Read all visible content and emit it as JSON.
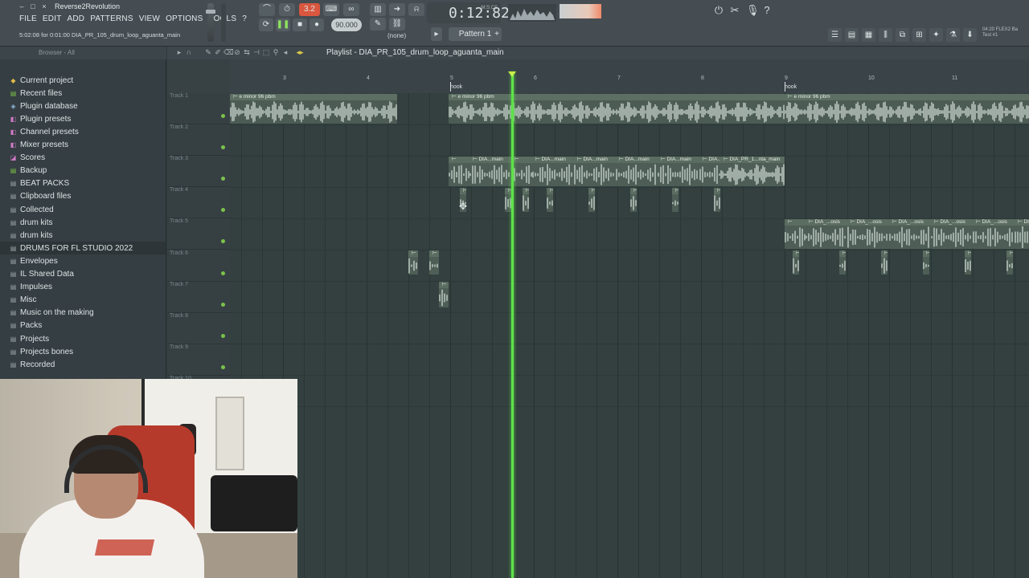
{
  "window": {
    "title": "Reverse2Revolution",
    "hint_text": "5:02:08 for 0:01:00 DIA_PR_105_drum_loop_aguanta_main"
  },
  "menu": [
    "FILE",
    "EDIT",
    "ADD",
    "PATTERNS",
    "VIEW",
    "OPTIONS",
    "TOOLS",
    "?"
  ],
  "transport": {
    "tempo": "90.000",
    "time": "0:12:82",
    "time_unit": "M:S:CS",
    "pattern": "Pattern 1",
    "snap": "(none)",
    "step_value": "3.2"
  },
  "right_panel": {
    "line1": "04:20 FLEX2 Ba",
    "line2": "Test #1"
  },
  "browser": {
    "header": "Browser - All",
    "items": [
      {
        "label": "Current project",
        "icon": "project-icon",
        "color": "#e0b94a"
      },
      {
        "label": "Recent files",
        "icon": "folder-icon",
        "color": "#7bc24a"
      },
      {
        "label": "Plugin database",
        "icon": "plugin-icon",
        "color": "#8fb4d6"
      },
      {
        "label": "Plugin presets",
        "icon": "preset-icon",
        "color": "#d07ac8"
      },
      {
        "label": "Channel presets",
        "icon": "preset-icon",
        "color": "#d07ac8"
      },
      {
        "label": "Mixer presets",
        "icon": "preset-icon",
        "color": "#d07ac8"
      },
      {
        "label": "Scores",
        "icon": "score-icon",
        "color": "#d07ac8"
      },
      {
        "label": "Backup",
        "icon": "folder-icon",
        "color": "#7bc24a"
      },
      {
        "label": "BEAT PACKS",
        "icon": "folder-icon",
        "color": "#9aa6aa"
      },
      {
        "label": "Clipboard files",
        "icon": "folder-icon",
        "color": "#9aa6aa"
      },
      {
        "label": "Collected",
        "icon": "folder-icon",
        "color": "#9aa6aa"
      },
      {
        "label": "drum kits",
        "icon": "folder-icon",
        "color": "#9aa6aa"
      },
      {
        "label": "drum kits",
        "icon": "folder-icon",
        "color": "#9aa6aa"
      },
      {
        "label": "DRUMS FOR FL STUDIO 2022",
        "icon": "folder-icon",
        "color": "#9aa6aa",
        "selected": true
      },
      {
        "label": "Envelopes",
        "icon": "folder-icon",
        "color": "#9aa6aa"
      },
      {
        "label": "IL Shared Data",
        "icon": "folder-icon",
        "color": "#9aa6aa"
      },
      {
        "label": "Impulses",
        "icon": "folder-icon",
        "color": "#9aa6aa"
      },
      {
        "label": "Misc",
        "icon": "folder-icon",
        "color": "#9aa6aa"
      },
      {
        "label": "Music on the making",
        "icon": "folder-icon",
        "color": "#9aa6aa"
      },
      {
        "label": "Packs",
        "icon": "folder-icon",
        "color": "#9aa6aa"
      },
      {
        "label": "Projects",
        "icon": "folder-icon",
        "color": "#9aa6aa"
      },
      {
        "label": "Projects bones",
        "icon": "folder-icon",
        "color": "#9aa6aa"
      },
      {
        "label": "Recorded",
        "icon": "folder-icon",
        "color": "#9aa6aa"
      }
    ]
  },
  "playlist": {
    "title": "Playlist - DIA_PR_105_drum_loop_aguanta_main",
    "tracks": [
      "Track 1",
      "Track 2",
      "Track 3",
      "Track 4",
      "Track 5",
      "Track 6",
      "Track 7",
      "Track 8",
      "Track 9",
      "Track 10"
    ],
    "bar_numbers": [
      "3",
      "4",
      "5",
      "6",
      "7",
      "8",
      "9",
      "10",
      "11"
    ],
    "markers": [
      "hook",
      "hook"
    ],
    "clip_names": {
      "loop": "e minor 96 pbm",
      "main": "DIA...main",
      "main_long": "DIA_PR_1...nta_main",
      "osis": "DIA_...osis"
    },
    "accent_color": "#5fe24a"
  }
}
